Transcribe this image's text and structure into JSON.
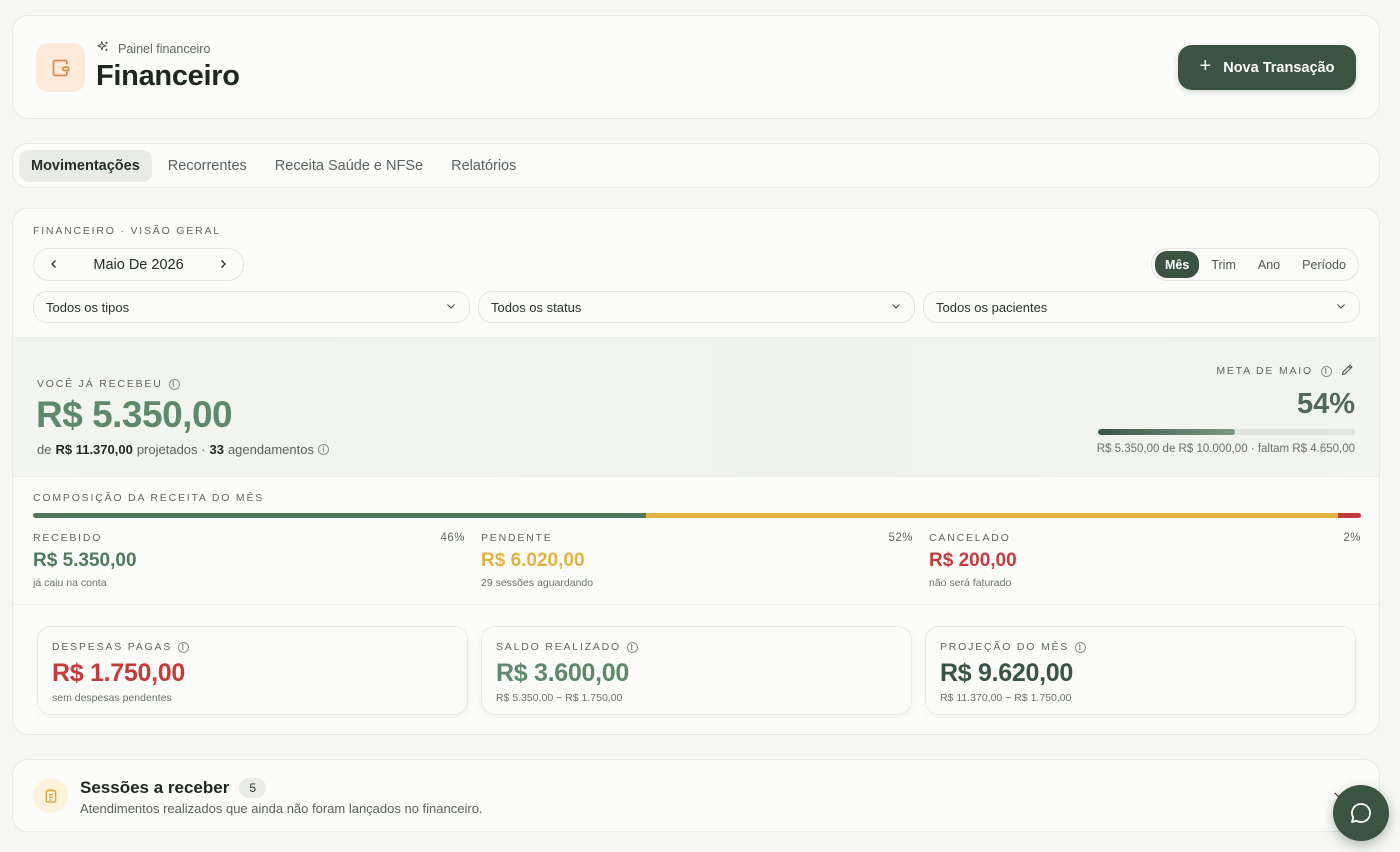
{
  "header": {
    "eyebrow": "Painel financeiro",
    "title": "Financeiro",
    "new_button": "Nova Transação",
    "icon": "wallet-icon"
  },
  "tabs": [
    {
      "label": "Movimentações",
      "active": true
    },
    {
      "label": "Recorrentes",
      "active": false
    },
    {
      "label": "Receita Saúde e NFSe",
      "active": false
    },
    {
      "label": "Relatórios",
      "active": false
    }
  ],
  "overview": {
    "label": "FINANCEIRO · VISÃO GERAL",
    "month": "Maio De 2026",
    "periods": [
      "Mês",
      "Trim",
      "Ano",
      "Período"
    ],
    "active_period": "Mês",
    "filters": {
      "type": "Todos os tipos",
      "status": "Todos os status",
      "patients": "Todos os pacientes"
    }
  },
  "received": {
    "label": "VOCÊ JÁ RECEBEU",
    "value": "R$ 5.350,00",
    "sub_prefix": "de",
    "projected": "R$ 11.370,00",
    "projected_label": "projetados ·",
    "appointments": "33",
    "appointments_label": "agendamentos"
  },
  "goal": {
    "label": "META DE MAIO",
    "percent_text": "54%",
    "progress": 0.535,
    "detail": "R$ 5.350,00 de R$ 10.000,00 · faltam R$ 4.650,00"
  },
  "composition": {
    "label": "COMPOSIÇÃO DA RECEITA DO MÊS",
    "segments": [
      {
        "name": "RECEBIDO",
        "pct_text": "46%",
        "share": 0.47,
        "value": "R$ 5.350,00",
        "desc": "já caiu na conta",
        "color": "#4f7a5c"
      },
      {
        "name": "PENDENTE",
        "pct_text": "52%",
        "share": 0.53,
        "value": "R$ 6.020,00",
        "desc": "29 sessões aguardando",
        "color": "#e3b341"
      },
      {
        "name": "CANCELADO",
        "pct_text": "2%",
        "share": 0.018,
        "value": "R$ 200,00",
        "desc": "não será faturado",
        "color": "#c43b3b"
      }
    ]
  },
  "summary": [
    {
      "label": "DESPESAS PAGAS",
      "value": "R$ 1.750,00",
      "desc": "sem despesas pendentes",
      "color": "#c43b3b"
    },
    {
      "label": "SALDO REALIZADO",
      "value": "R$ 3.600,00",
      "desc": "R$ 5.350,00 − R$ 1.750,00",
      "color": "#5e8a6b"
    },
    {
      "label": "PROJEÇÃO DO MÊS",
      "value": "R$ 9.620,00",
      "desc": "R$ 11.370,00 − R$ 1.750,00",
      "color": "#3b5442"
    }
  ],
  "sessions": {
    "title": "Sessões a receber",
    "count": "5",
    "desc": "Atendimentos realizados que ainda não foram lançados no financeiro."
  },
  "colors": {
    "primary": "#3b5442",
    "success": "#5e8a6b",
    "warning": "#e3b341",
    "danger": "#c43b3b"
  }
}
